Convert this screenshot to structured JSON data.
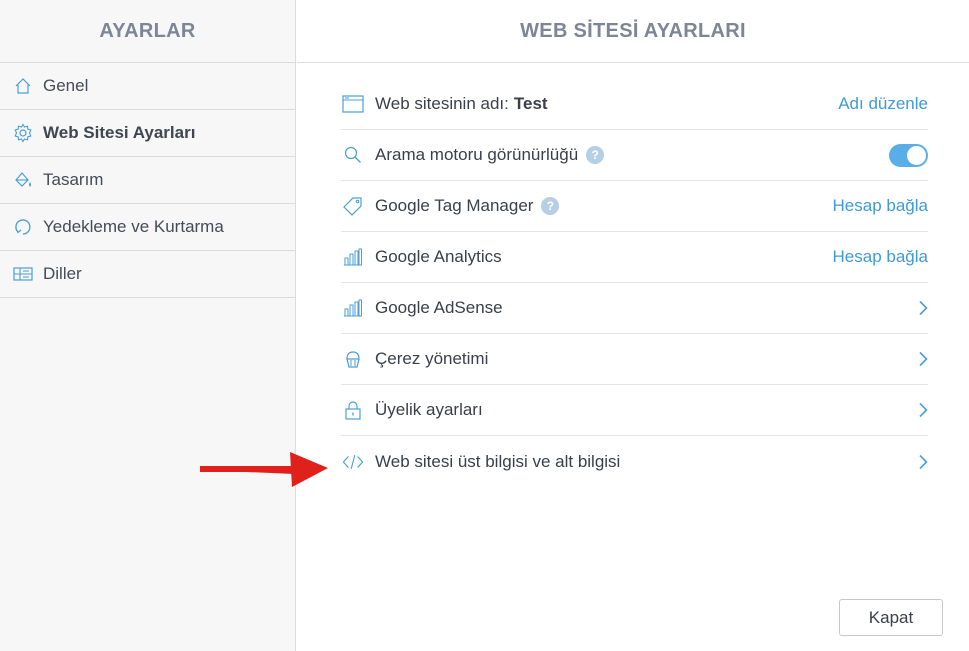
{
  "sidebar": {
    "title": "AYARLAR",
    "items": [
      {
        "label": "Genel",
        "icon": "home-icon"
      },
      {
        "label": "Web Sitesi Ayarları",
        "icon": "gear-icon",
        "active": true
      },
      {
        "label": "Tasarım",
        "icon": "paint-bucket-icon"
      },
      {
        "label": "Yedekleme ve Kurtarma",
        "icon": "restore-icon"
      },
      {
        "label": "Diller",
        "icon": "languages-icon"
      }
    ]
  },
  "main": {
    "title": "WEB SİTESİ AYARLARI",
    "rows": [
      {
        "label": "Web sitesinin adı:",
        "value": "Test",
        "icon": "browser-window-icon",
        "action": "Adı düzenle"
      },
      {
        "label": "Arama motoru görünürlüğü",
        "icon": "search-icon",
        "help": "?",
        "toggle": true
      },
      {
        "label": "Google Tag Manager",
        "icon": "tag-icon",
        "help": "?",
        "action": "Hesap bağla"
      },
      {
        "label": "Google Analytics",
        "icon": "bar-chart-icon",
        "action": "Hesap bağla"
      },
      {
        "label": "Google AdSense",
        "icon": "bar-chart-icon"
      },
      {
        "label": "Çerez yönetimi",
        "icon": "cookie-cupcake-icon"
      },
      {
        "label": "Üyelik ayarları",
        "icon": "lock-icon"
      },
      {
        "label": "Web sitesi üst bilgisi ve alt bilgisi",
        "icon": "code-icon"
      }
    ],
    "close_label": "Kapat"
  },
  "colors": {
    "accent": "#3f9ad8",
    "toggle_on": "#5aaee7",
    "annotation_arrow": "#e0201b",
    "header_text": "#7d8596"
  }
}
